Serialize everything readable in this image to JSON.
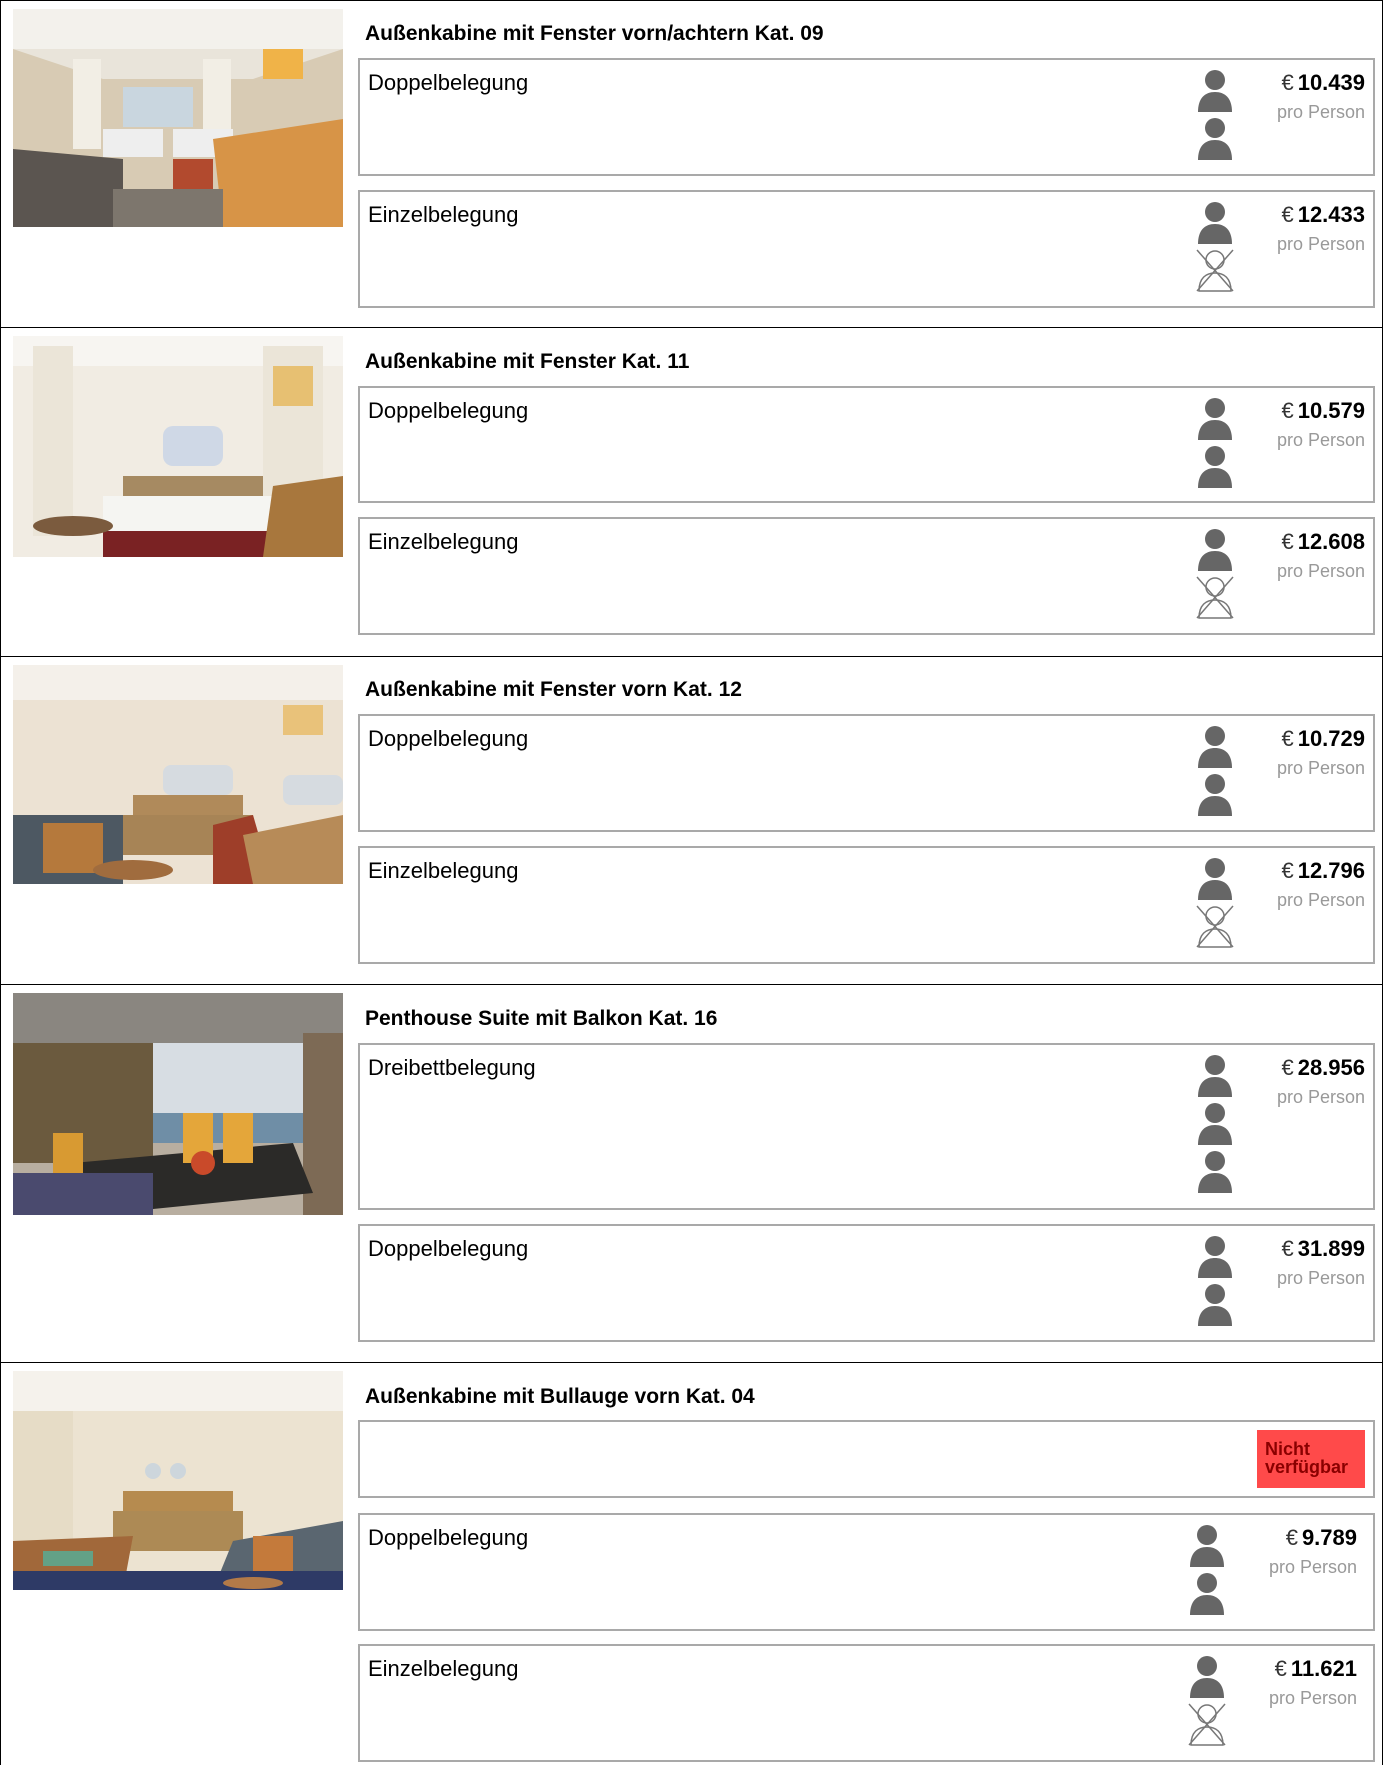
{
  "cabins": [
    {
      "title": "Außenkabine mit Fenster vorn/achtern Kat. 09",
      "photo": "cabin-photo-twin-beds",
      "options": [
        {
          "label": "Doppelbelegung",
          "price": "10.439",
          "currency": "€",
          "per": "pro Person",
          "persons": [
            "person-icon",
            "person-icon"
          ]
        },
        {
          "label": "Einzelbelegung",
          "price": "12.433",
          "currency": "€",
          "per": "pro Person",
          "persons": [
            "person-icon",
            "person-crossed-icon"
          ]
        }
      ]
    },
    {
      "title": "Außenkabine mit Fenster Kat. 11",
      "photo": "cabin-photo-double-bed",
      "options": [
        {
          "label": "Doppelbelegung",
          "price": "10.579",
          "currency": "€",
          "per": "pro Person",
          "persons": [
            "person-icon",
            "person-icon"
          ]
        },
        {
          "label": "Einzelbelegung",
          "price": "12.608",
          "currency": "€",
          "per": "pro Person",
          "persons": [
            "person-icon",
            "person-crossed-icon"
          ]
        }
      ]
    },
    {
      "title": "Außenkabine mit Fenster vorn Kat. 12",
      "photo": "cabin-photo-double-bed-sofa",
      "options": [
        {
          "label": "Doppelbelegung",
          "price": "10.729",
          "currency": "€",
          "per": "pro Person",
          "persons": [
            "person-icon",
            "person-icon"
          ]
        },
        {
          "label": "Einzelbelegung",
          "price": "12.796",
          "currency": "€",
          "per": "pro Person",
          "persons": [
            "person-icon",
            "person-crossed-icon"
          ]
        }
      ]
    },
    {
      "title": "Penthouse Suite mit Balkon Kat. 16",
      "photo": "suite-photo-balcony",
      "options": [
        {
          "label": "Dreibettbelegung",
          "price": "28.956",
          "currency": "€",
          "per": "pro Person",
          "persons": [
            "person-icon",
            "person-icon",
            "person-icon"
          ]
        },
        {
          "label": "Doppelbelegung",
          "price": "31.899",
          "currency": "€",
          "per": "pro Person",
          "persons": [
            "person-icon",
            "person-icon"
          ]
        }
      ]
    },
    {
      "title": "Außenkabine mit Bullauge vorn Kat. 04",
      "photo": "cabin-photo-porthole",
      "unavailable": "Nicht verfügbar",
      "options": [
        {
          "label": "Doppelbelegung",
          "price": "9.789",
          "currency": "€",
          "per": "pro Person",
          "persons": [
            "person-icon",
            "person-icon"
          ]
        },
        {
          "label": "Einzelbelegung",
          "price": "11.621",
          "currency": "€",
          "per": "pro Person",
          "persons": [
            "person-icon",
            "person-crossed-icon"
          ]
        }
      ]
    }
  ]
}
